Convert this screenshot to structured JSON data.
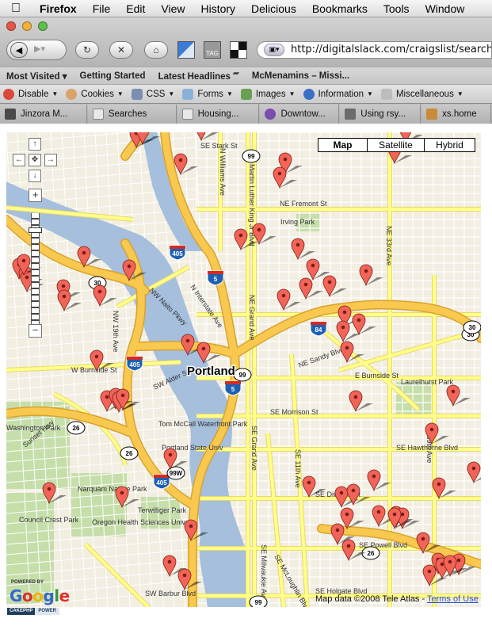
{
  "menubar": {
    "app_name": "Firefox",
    "items": [
      "File",
      "Edit",
      "View",
      "History",
      "Delicious",
      "Bookmarks",
      "Tools",
      "Window"
    ]
  },
  "toolbar": {
    "url": "http://digitalslack.com/craigslist/searches",
    "tag_label": "TAG"
  },
  "bookmarks": [
    "Most Visited",
    "Getting Started",
    "Latest Headlines",
    "McMenamins – Missi..."
  ],
  "devbar": [
    "Disable",
    "Cookies",
    "CSS",
    "Forms",
    "Images",
    "Information",
    "Miscellaneous"
  ],
  "tabs": [
    "Jinzora M...",
    "Searches",
    "Housing...",
    "Downtow...",
    "Using rsy...",
    "xs.home"
  ],
  "map": {
    "type_buttons": [
      "Map",
      "Satellite",
      "Hybrid"
    ],
    "active_type": "Map",
    "city_label": "Portland",
    "labels": [
      {
        "text": "NE Fremont St",
        "rot": 0
      },
      {
        "text": "Irving Park",
        "rot": 0
      },
      {
        "text": "N Williams Ave",
        "rot": 90
      },
      {
        "text": "NE Martin Luther King Jr Blvd",
        "rot": 90
      },
      {
        "text": "NE 33rd Ave",
        "rot": 90
      },
      {
        "text": "NE Grand Ave",
        "rot": 90
      },
      {
        "text": "N Interstate Ave",
        "rot": 55
      },
      {
        "text": "NW Naito Pkwy",
        "rot": 45
      },
      {
        "text": "NW 19th Ave",
        "rot": 90
      },
      {
        "text": "W Burnside St",
        "rot": 0
      },
      {
        "text": "SW Alder St",
        "rot": -25
      },
      {
        "text": "NE Sandy Blvd",
        "rot": -20
      },
      {
        "text": "E Burnside St",
        "rot": 0
      },
      {
        "text": "Laurelhurst Park",
        "rot": 0
      },
      {
        "text": "SE Morrison St",
        "rot": 0
      },
      {
        "text": "SE Hawthorne Blvd",
        "rot": 0
      },
      {
        "text": "SE 39th Ave",
        "rot": 90
      },
      {
        "text": "Washington Park",
        "rot": 0
      },
      {
        "text": "Sunset Hwy",
        "rot": -40
      },
      {
        "text": "Tom McCall Waterfront Park",
        "rot": 0
      },
      {
        "text": "Portland State Univ",
        "rot": 0
      },
      {
        "text": "SE Grand Ave",
        "rot": 90
      },
      {
        "text": "SE 11th Ave",
        "rot": 90
      },
      {
        "text": "SE Division St",
        "rot": 0
      },
      {
        "text": "Narquam Nature Park",
        "rot": 0
      },
      {
        "text": "Terwilliger Park",
        "rot": 0
      },
      {
        "text": "Oregon Health Sciences Univer",
        "rot": 0
      },
      {
        "text": "Council Crest Park",
        "rot": 0
      },
      {
        "text": "SE Powell Blvd",
        "rot": 0
      },
      {
        "text": "SE Milwaukie Ave",
        "rot": 90
      },
      {
        "text": "SE McLoughlin Blvd",
        "rot": 60
      },
      {
        "text": "SE Holgate Blvd",
        "rot": 0
      },
      {
        "text": "SW Barbur Blvd",
        "rot": 0
      },
      {
        "text": "SE Stark St",
        "rot": 0
      }
    ],
    "shields": [
      {
        "kind": "interstate",
        "num": "405"
      },
      {
        "kind": "interstate",
        "num": "5"
      },
      {
        "kind": "interstate",
        "num": "84"
      },
      {
        "kind": "interstate",
        "num": "405"
      },
      {
        "kind": "interstate",
        "num": "405"
      },
      {
        "kind": "interstate",
        "num": "5"
      },
      {
        "kind": "us",
        "num": "30"
      },
      {
        "kind": "us",
        "num": "30"
      },
      {
        "kind": "us",
        "num": "99"
      },
      {
        "kind": "us",
        "num": "99"
      },
      {
        "kind": "us",
        "num": "99"
      },
      {
        "kind": "us",
        "num": "26"
      },
      {
        "kind": "us",
        "num": "26"
      },
      {
        "kind": "us",
        "num": "26"
      },
      {
        "kind": "us",
        "num": "99W"
      },
      {
        "kind": "us",
        "num": "30"
      }
    ],
    "marker_count": 66,
    "attribution": "Map data ©2008 Tele Atlas",
    "terms": "Terms of Use",
    "powered_by": "POWERED BY",
    "google_letters": [
      "G",
      "o",
      "o",
      "g",
      "l",
      "e"
    ],
    "colors": {
      "water": "#a5bfdd",
      "highway": "#f8c94e",
      "arterial": "#ffff8a",
      "park": "#c6deaa",
      "marker": "#f26457"
    }
  },
  "footer": {
    "cakephp_a": "CAKEPHP",
    "cakephp_b": "POWER"
  }
}
